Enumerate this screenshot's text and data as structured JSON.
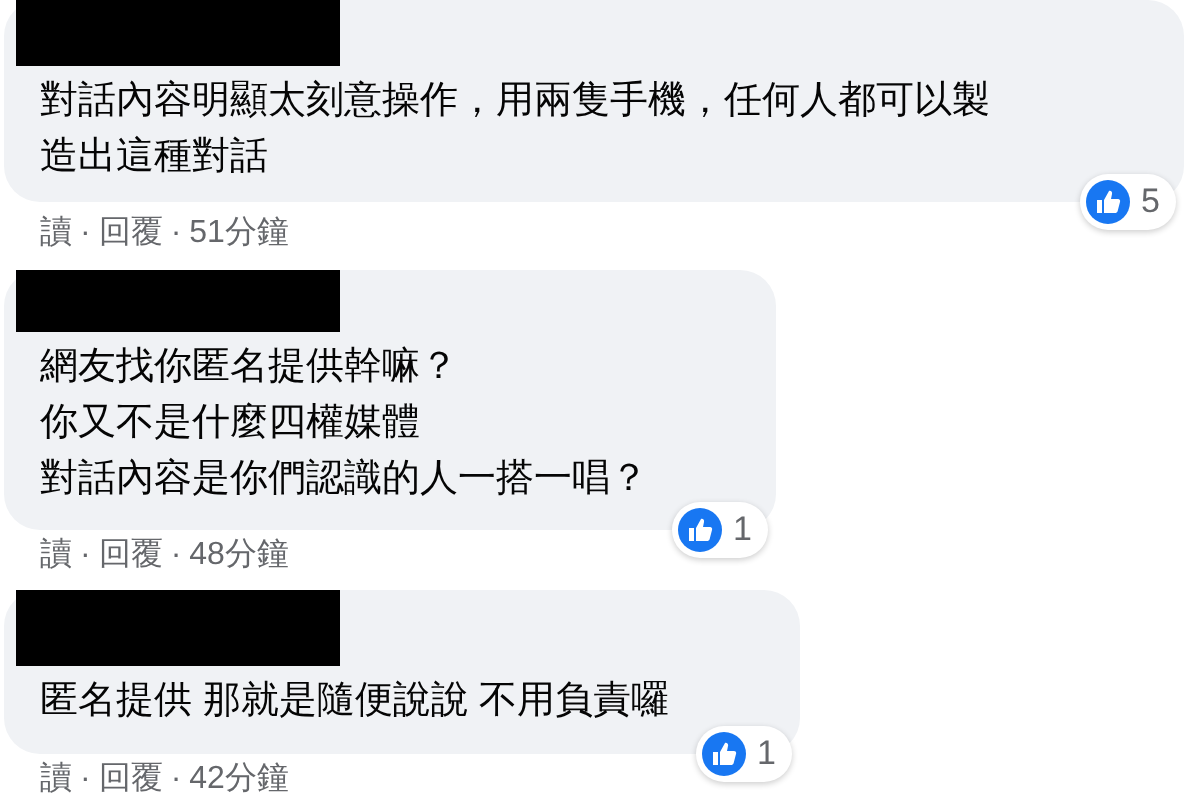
{
  "comments": [
    {
      "lines": [
        "對話內容明顯太刻意操作，用兩隻手機，任何人都可以製",
        "造出這種對話"
      ],
      "reaction_count": "5",
      "meta": [
        {
          "kind": "link",
          "text": "讀"
        },
        {
          "kind": "dot",
          "text": "·"
        },
        {
          "kind": "link",
          "text": "回覆"
        },
        {
          "kind": "dot",
          "text": "·"
        },
        {
          "kind": "time",
          "text": "51分鐘"
        }
      ]
    },
    {
      "lines": [
        "網友找你匿名提供幹嘛？",
        "你又不是什麼四權媒體",
        "對話內容是你們認識的人一搭一唱？"
      ],
      "reaction_count": "1",
      "meta": [
        {
          "kind": "link",
          "text": "讀"
        },
        {
          "kind": "dot",
          "text": "·"
        },
        {
          "kind": "link",
          "text": "回覆"
        },
        {
          "kind": "dot",
          "text": "·"
        },
        {
          "kind": "time",
          "text": "48分鐘"
        }
      ]
    },
    {
      "lines": [
        "匿名提供 那就是隨便說說 不用負責囉"
      ],
      "reaction_count": "1",
      "meta": [
        {
          "kind": "link",
          "text": "讀"
        },
        {
          "kind": "dot",
          "text": "·"
        },
        {
          "kind": "link",
          "text": "回覆"
        },
        {
          "kind": "dot",
          "text": "·"
        },
        {
          "kind": "time",
          "text": "42分鐘"
        }
      ]
    }
  ]
}
